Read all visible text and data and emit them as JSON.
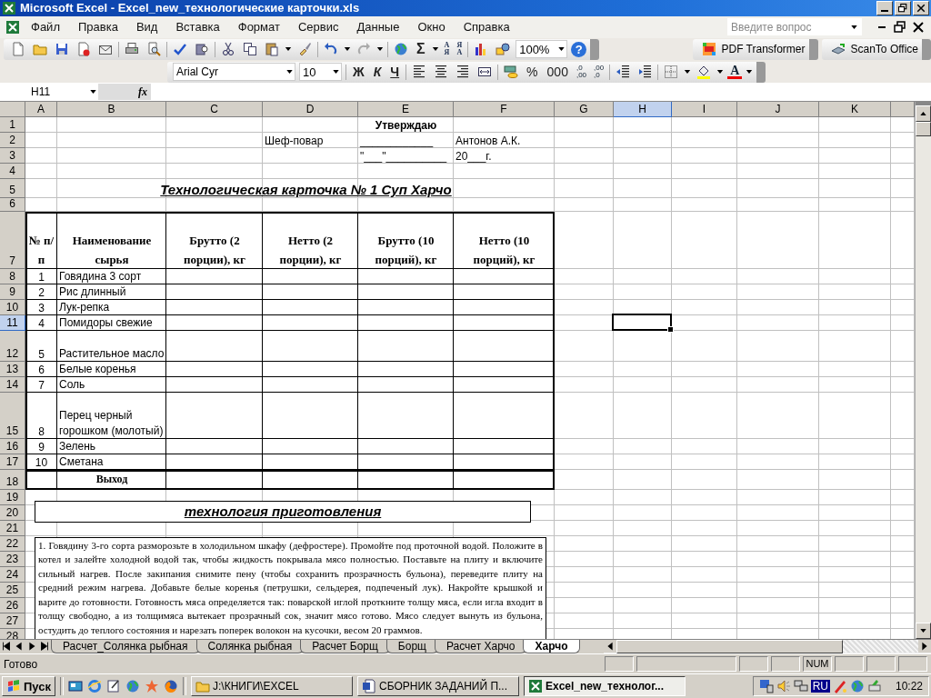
{
  "window": {
    "title": "Microsoft Excel - Excel_new_технологические карточки.xls"
  },
  "menu": {
    "items": [
      {
        "label": "Файл"
      },
      {
        "label": "Правка"
      },
      {
        "label": "Вид"
      },
      {
        "label": "Вставка"
      },
      {
        "label": "Формат"
      },
      {
        "label": "Сервис"
      },
      {
        "label": "Данные"
      },
      {
        "label": "Окно"
      },
      {
        "label": "Справка"
      }
    ],
    "help_placeholder": "Введите вопрос"
  },
  "standard_toolbar": {
    "sum": "Σ",
    "sort_ascending": [
      "А",
      "Я"
    ],
    "sort_descending": [
      "Я",
      "А"
    ],
    "zoom": "100%",
    "help": "?"
  },
  "extra_toolbars": [
    {
      "kind": "pdf",
      "label": "PDF Transformer"
    },
    {
      "kind": "scan",
      "label": "ScanTo Office"
    }
  ],
  "formatting_toolbar": {
    "font": "Arial Cyr",
    "size": "10",
    "bold": "Ж",
    "italic": "К",
    "underline": "Ч",
    "percent": "%",
    "thousands": "000",
    "increase_decimal": [
      ",0",
      ",00"
    ],
    "decrease_decimal": [
      ",00",
      ",0"
    ],
    "font_color": "A"
  },
  "formula_bar": {
    "name_box": "H11",
    "function_label": "fx"
  },
  "sheet": {
    "columns": [
      {
        "label": "A",
        "selected": false
      },
      {
        "label": "B",
        "selected": false
      },
      {
        "label": "C",
        "selected": false
      },
      {
        "label": "D",
        "selected": false
      },
      {
        "label": "E",
        "selected": false
      },
      {
        "label": "F",
        "selected": false
      },
      {
        "label": "G",
        "selected": false
      },
      {
        "label": "H",
        "selected": true
      },
      {
        "label": "I",
        "selected": false
      },
      {
        "label": "J",
        "selected": false
      },
      {
        "label": "K",
        "selected": false
      }
    ],
    "rows": [
      {
        "label": "1",
        "selected": false
      },
      {
        "label": "2",
        "selected": false
      },
      {
        "label": "3",
        "selected": false
      },
      {
        "label": "4",
        "selected": false
      },
      {
        "label": "5",
        "selected": false
      },
      {
        "label": "6",
        "selected": false
      },
      {
        "label": "7",
        "selected": false
      },
      {
        "label": "8",
        "selected": false
      },
      {
        "label": "9",
        "selected": false
      },
      {
        "label": "10",
        "selected": false
      },
      {
        "label": "11",
        "selected": true
      },
      {
        "label": "12",
        "selected": false
      },
      {
        "label": "13",
        "selected": false
      },
      {
        "label": "14",
        "selected": false
      },
      {
        "label": "15",
        "selected": false
      },
      {
        "label": "16",
        "selected": false
      },
      {
        "label": "17",
        "selected": false
      },
      {
        "label": "18",
        "selected": false
      },
      {
        "label": "19",
        "selected": false
      },
      {
        "label": "20",
        "selected": false
      },
      {
        "label": "21",
        "selected": false
      },
      {
        "label": "22",
        "selected": false
      },
      {
        "label": "23",
        "selected": false
      },
      {
        "label": "24",
        "selected": false
      },
      {
        "label": "25",
        "selected": false
      },
      {
        "label": "26",
        "selected": false
      },
      {
        "label": "27",
        "selected": false
      },
      {
        "label": "28",
        "selected": false
      }
    ],
    "approval": {
      "heading": "Утверждаю",
      "role": "Шеф-повар",
      "signature": "____________",
      "name": "Антонов А.К.",
      "date": "\"___\"__________",
      "year": "20___г."
    },
    "title": "Технологическая карточка № 1 Суп Харчо",
    "table": {
      "columns": [
        "№ п/п",
        "Наименование сырья",
        "Брутто (2 порции), кг",
        "Нетто (2 порции), кг",
        "Брутто (10 порций), кг",
        "Нетто (10 порций), кг"
      ],
      "items": [
        {
          "number": "1",
          "name": "Говядина 3 сорт"
        },
        {
          "number": "2",
          "name": "Рис длинный"
        },
        {
          "number": "3",
          "name": "Лук-репка"
        },
        {
          "number": "4",
          "name": "Помидоры свежие"
        },
        {
          "number": "5",
          "name": "Растительное масло"
        },
        {
          "number": "6",
          "name": "Белые коренья"
        },
        {
          "number": "7",
          "name": "Соль"
        },
        {
          "number": "8",
          "name": "Перец черный горошком (молотый)"
        },
        {
          "number": "9",
          "name": "Зелень"
        },
        {
          "number": "10",
          "name": "Сметана"
        }
      ],
      "total": "Выход"
    },
    "method_heading": "технология приготовления",
    "method_text": "1. Говядину 3-го сорта разморозьте в холодильном шкафу (дефростере). Промойте под проточной водой. Положите в котел и залейте холодной водой так, чтобы жидкость покрывала мясо полностью. Поставьте на плиту и включите сильный нагрев. После закипания снимите пену (чтобы сохранить прозрачность бульона), переведите плиту на средний режим нагрева. Добавьте белые коренья (петрушки, сельдерея, подпеченый лук). Накройте крышкой и варите до готовности. Готовность мяса определяется так: поварской иглой проткните толщу мяса, если игла входит в толщу свободно, а из толщимяса вытекает прозрачный сок, значит мясо готово. Мясо следует вынуть из бульона, остудить до теплого состояния и нарезать поперек волокон на кусочки, весом 20 граммов."
  },
  "sheet_tabs": [
    {
      "label": "Расчет_Солянка рыбная",
      "selected": false
    },
    {
      "label": "Солянка рыбная",
      "selected": false
    },
    {
      "label": "Расчет Борщ",
      "selected": false
    },
    {
      "label": "Борщ",
      "selected": false
    },
    {
      "label": "Расчет Харчо",
      "selected": false
    },
    {
      "label": "Харчо",
      "selected": true
    }
  ],
  "status_bar": {
    "text": "Готово",
    "num": "NUM"
  },
  "taskbar": {
    "start": "Пуск",
    "tasks": [
      {
        "kind": "folder",
        "label": "J:\\КНИГИ\\EXCEL",
        "selected": false
      },
      {
        "kind": "word",
        "label": "СБОРНИК ЗАДАНИЙ П...",
        "selected": false
      },
      {
        "kind": "excel",
        "label": "Excel_new_технолог...",
        "selected": true
      }
    ],
    "language": "RU",
    "clock": "10:22"
  }
}
